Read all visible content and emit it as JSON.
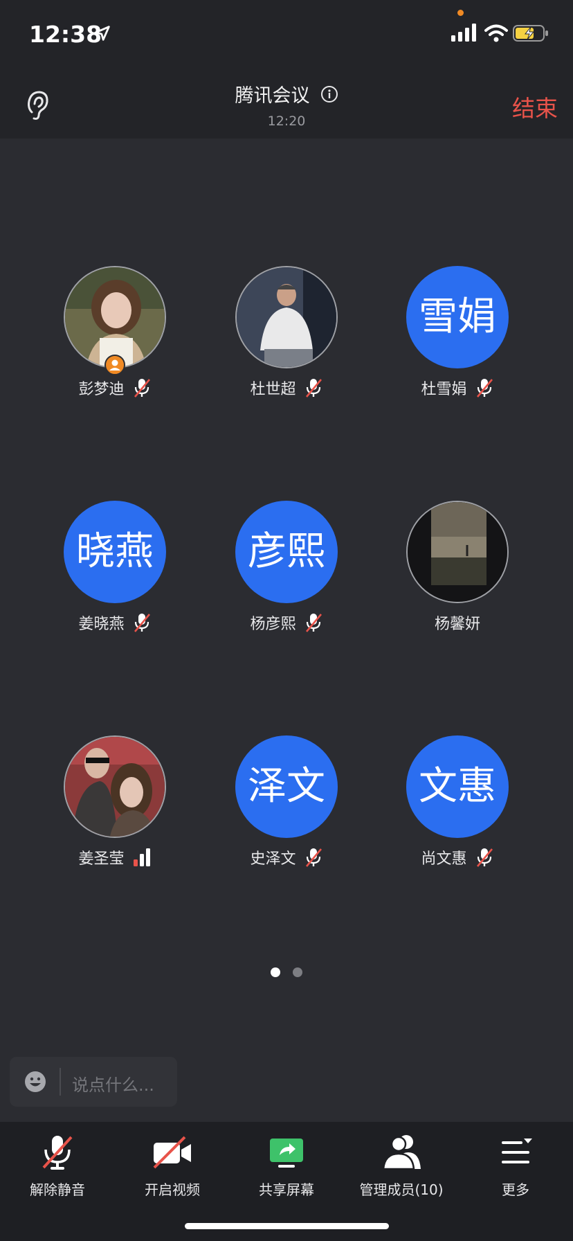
{
  "status_bar": {
    "time": "12:38"
  },
  "header": {
    "title": "腾讯会议",
    "elapsed": "12:20",
    "end_label": "结束"
  },
  "participants": [
    {
      "name": "彭梦迪",
      "avatar_type": "photo",
      "avatar_text": "",
      "host": true,
      "mic": "muted"
    },
    {
      "name": "杜世超",
      "avatar_type": "photo",
      "avatar_text": "",
      "host": false,
      "mic": "muted"
    },
    {
      "name": "杜雪娟",
      "avatar_type": "text",
      "avatar_text": "雪娟",
      "host": false,
      "mic": "muted"
    },
    {
      "name": "姜晓燕",
      "avatar_type": "text",
      "avatar_text": "晓燕",
      "host": false,
      "mic": "muted"
    },
    {
      "name": "杨彦熙",
      "avatar_type": "text",
      "avatar_text": "彦熙",
      "host": false,
      "mic": "muted"
    },
    {
      "name": "杨馨妍",
      "avatar_type": "photo",
      "avatar_text": "",
      "host": false,
      "mic": "none"
    },
    {
      "name": "姜圣莹",
      "avatar_type": "photo",
      "avatar_text": "",
      "host": false,
      "mic": "speaking"
    },
    {
      "name": "史泽文",
      "avatar_type": "text",
      "avatar_text": "泽文",
      "host": false,
      "mic": "muted"
    },
    {
      "name": "尚文惠",
      "avatar_type": "text",
      "avatar_text": "文惠",
      "host": false,
      "mic": "muted"
    }
  ],
  "pager": {
    "pages": 2,
    "current": 1
  },
  "chat": {
    "placeholder": "说点什么..."
  },
  "toolbar": {
    "unmute_label": "解除静音",
    "video_label": "开启视频",
    "share_label": "共享屏幕",
    "members_label": "管理成员(10)",
    "more_label": "更多"
  },
  "colors": {
    "accent_blue": "#2b6ef0",
    "end_red": "#e8534a",
    "share_green": "#3ec26a",
    "host_orange": "#f08a24"
  }
}
